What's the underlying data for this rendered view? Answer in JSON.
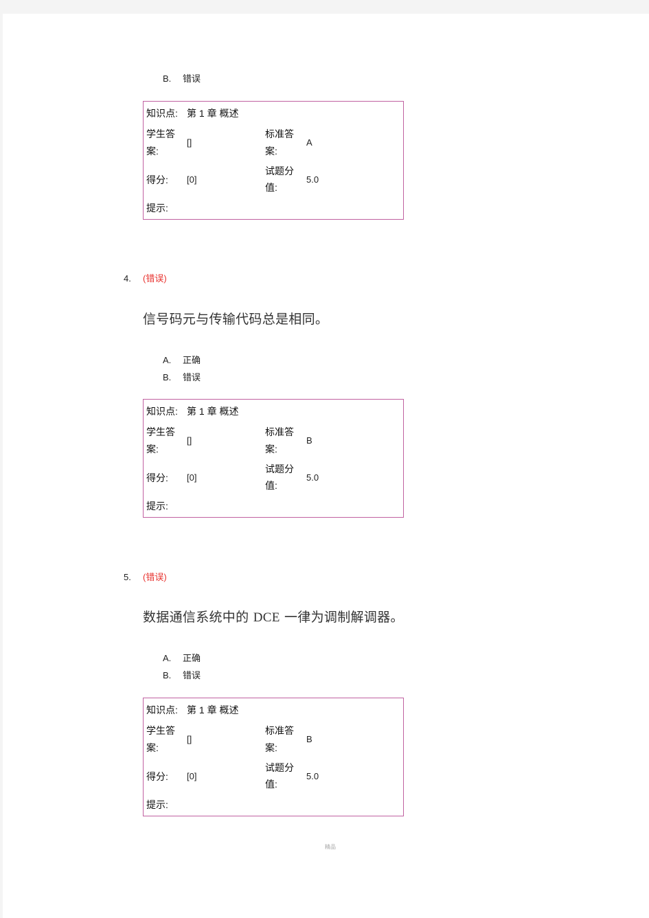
{
  "top_partial": {
    "options": [
      {
        "letter": "B.",
        "text": "错误"
      }
    ],
    "info": {
      "knowledge_label": "知识点:",
      "knowledge_value": "第 1 章  概述",
      "student_answer_label_1": "学生答",
      "student_answer_label_2": "案:",
      "student_answer_value": "[]",
      "standard_answer_label_1": "标准答",
      "standard_answer_label_2": "案:",
      "standard_answer_value": "A",
      "score_label": "得分:",
      "score_value": "[0]",
      "points_label_1": "试题分",
      "points_label_2": "值:",
      "points_value": "5.0",
      "hint_label": "提示:"
    }
  },
  "questions": [
    {
      "number": "4.",
      "status": "(错误)",
      "text": "信号码元与传输代码总是相同。",
      "options": [
        {
          "letter": "A.",
          "text": "正确"
        },
        {
          "letter": "B.",
          "text": "错误"
        }
      ],
      "info": {
        "knowledge_label": "知识点:",
        "knowledge_value": "第 1 章  概述",
        "student_answer_label_1": "学生答",
        "student_answer_label_2": "案:",
        "student_answer_value": "[]",
        "standard_answer_label_1": "标准答",
        "standard_answer_label_2": "案:",
        "standard_answer_value": "B",
        "score_label": "得分:",
        "score_value": "[0]",
        "points_label_1": "试题分",
        "points_label_2": "值:",
        "points_value": "5.0",
        "hint_label": "提示:"
      }
    },
    {
      "number": "5.",
      "status": "(错误)",
      "text_before": "数据通信系统中的 ",
      "text_latin": "DCE",
      "text_after": " 一律为调制解调器。",
      "options": [
        {
          "letter": "A.",
          "text": "正确"
        },
        {
          "letter": "B.",
          "text": "错误"
        }
      ],
      "info": {
        "knowledge_label": "知识点:",
        "knowledge_value": "第 1 章  概述",
        "student_answer_label_1": "学生答",
        "student_answer_label_2": "案:",
        "student_answer_value": "[]",
        "standard_answer_label_1": "标准答",
        "standard_answer_label_2": "案:",
        "standard_answer_value": "B",
        "score_label": "得分:",
        "score_value": "[0]",
        "points_label_1": "试题分",
        "points_label_2": "值:",
        "points_value": "5.0",
        "hint_label": "提示:"
      }
    }
  ],
  "footer": {
    "watermark": "精品"
  },
  "colors": {
    "status_error": "#e8322e",
    "box_border": "#c060a0",
    "page_bg": "#f4f4f4"
  }
}
